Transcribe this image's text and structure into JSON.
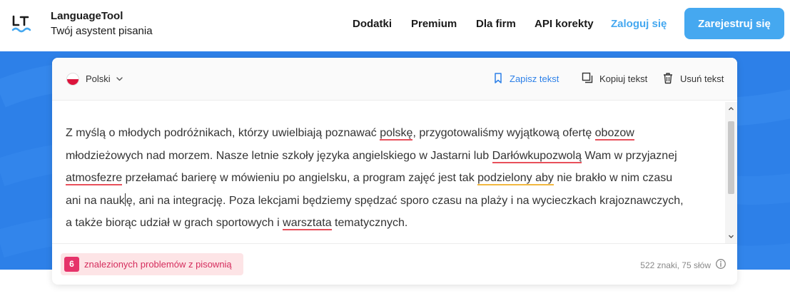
{
  "header": {
    "brand_name": "LanguageTool",
    "tagline": "Twój asystent pisania",
    "nav": [
      "Dodatki",
      "Premium",
      "Dla firm",
      "API korekty"
    ],
    "login": "Zaloguj się",
    "signup": "Zarejestruj się"
  },
  "toolbar": {
    "language": "Polski",
    "save": "Zapisz tekst",
    "copy": "Kopiuj tekst",
    "delete": "Usuń tekst"
  },
  "editor": {
    "lines": [
      [
        {
          "t": "Z myślą o młodych podróżnikach, którzy uwielbiają poznawać "
        },
        {
          "t": "polskę",
          "k": "err"
        },
        {
          "t": ", przygotowaliśmy wyjątkową ofertę "
        },
        {
          "t": "obozow",
          "k": "err"
        }
      ],
      [
        {
          "t": "młodzieżowych nad morzem. Nasze letnie szkoły języka angielskiego w Jastarni lub "
        },
        {
          "t": "Darłówkupozwolą",
          "k": "err"
        },
        {
          "t": " Wam w przyjaznej"
        }
      ],
      [
        {
          "t": "atmosfezre",
          "k": "err"
        },
        {
          "t": " przełamać barierę w mówieniu po angielsku, a program zajęć jest tak "
        },
        {
          "t": "podzielony aby",
          "k": "warn"
        },
        {
          "t": " nie brakło w nim czasu"
        }
      ],
      [
        {
          "t": "ani na nauk"
        },
        {
          "t": "",
          "k": "caret"
        },
        {
          "t": "ę, ani na integrację. Poza lekcjami będziemy spędzać sporo czasu na plaży i na wycieczkach krajoznawczych,"
        }
      ],
      [
        {
          "t": "a także biorąc udział w grach sportowych i "
        },
        {
          "t": "warsztata",
          "k": "err"
        },
        {
          "t": " tematycznych."
        }
      ]
    ]
  },
  "status": {
    "issue_count": "6",
    "issue_label": "znalezionych problemów z pisownią",
    "stats": "522 znaki, 75 słów"
  },
  "colors": {
    "accent": "#45a8f0",
    "band": "#2d80e8",
    "error_underline": "#e8505b",
    "warning_underline": "#f2b840",
    "issue_badge": "#e6336a"
  }
}
